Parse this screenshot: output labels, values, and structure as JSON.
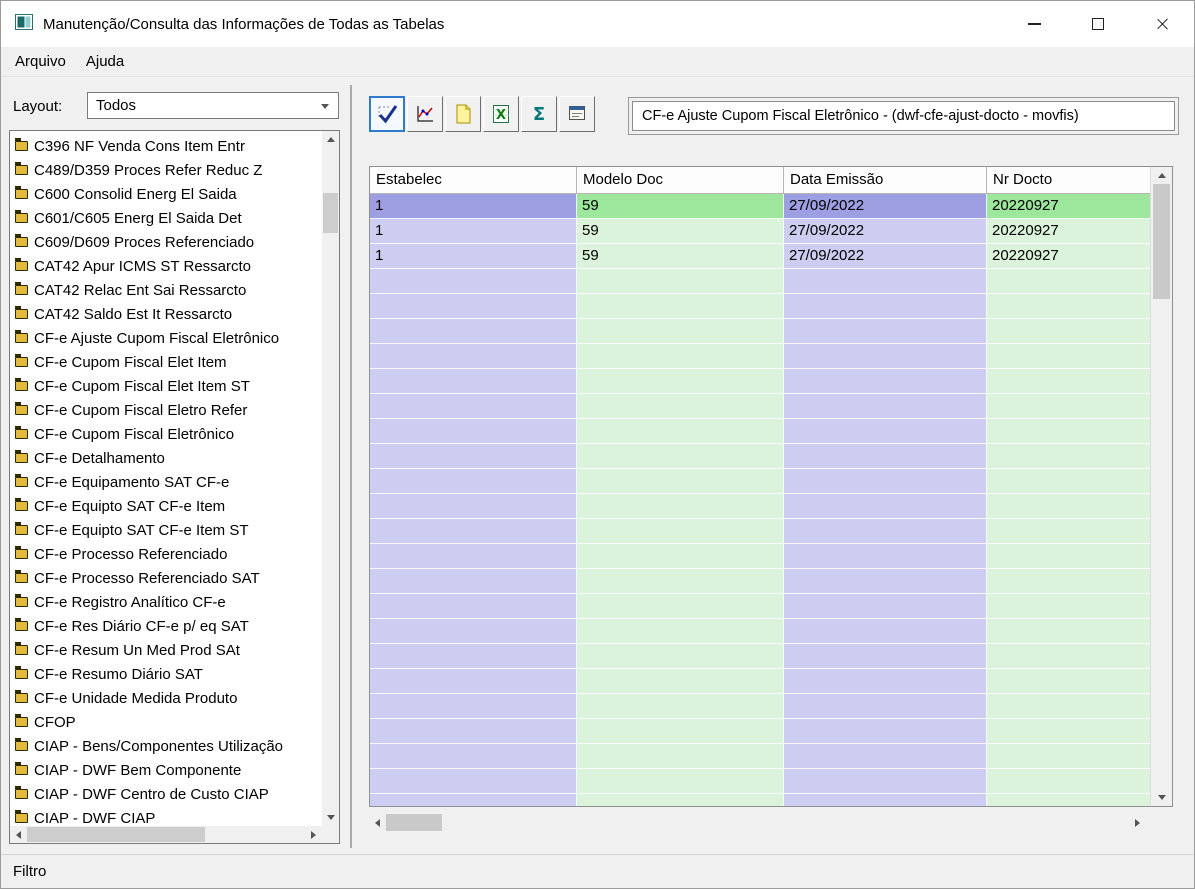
{
  "window": {
    "title": "Manutenção/Consulta das Informações de Todas as Tabelas"
  },
  "menu": {
    "items": [
      "Arquivo",
      "Ajuda"
    ]
  },
  "sidebar": {
    "layout_label": "Layout:",
    "layout_value": "Todos",
    "tables": [
      "C396 NF Venda Cons Item Entr",
      "C489/D359 Proces Refer Reduc Z",
      "C600 Consolid Energ El Saida",
      "C601/C605 Energ El Saida Det",
      "C609/D609 Proces Referenciado",
      "CAT42 Apur ICMS ST Ressarcto",
      "CAT42 Relac Ent Sai Ressarcto",
      "CAT42 Saldo Est It Ressarcto",
      "CF-e Ajuste Cupom Fiscal Eletrônico",
      "CF-e Cupom Fiscal Elet Item",
      "CF-e Cupom Fiscal Elet Item ST",
      "CF-e Cupom Fiscal Eletro Refer",
      "CF-e Cupom Fiscal Eletrônico",
      "CF-e Detalhamento",
      "CF-e Equipamento SAT CF-e",
      "CF-e Equipto SAT CF-e Item",
      "CF-e Equipto SAT CF-e Item ST",
      "CF-e Processo Referenciado",
      "CF-e Processo Referenciado SAT",
      "CF-e Registro Analítico CF-e",
      "CF-e Res Diário CF-e p/ eq SAT",
      "CF-e Resum Un Med Prod SAt",
      "CF-e Resumo Diário SAT",
      "CF-e Unidade Medida Produto",
      "CFOP",
      "CIAP - Bens/Componentes Utilização",
      "CIAP - DWF Bem Componente",
      "CIAP - DWF Centro de Custo CIAP",
      "CIAP - DWF CIAP"
    ]
  },
  "toolbar": {
    "buttons": [
      {
        "icon": "filter-check-icon"
      },
      {
        "icon": "chart-icon"
      },
      {
        "icon": "document-icon"
      },
      {
        "icon": "excel-icon",
        "glyph": "X"
      },
      {
        "icon": "sigma-icon",
        "glyph": "Σ"
      },
      {
        "icon": "properties-icon"
      }
    ],
    "selected_table": "CF-e Ajuste Cupom Fiscal Eletrônico - (dwf-cfe-ajust-docto - movfis)"
  },
  "grid": {
    "columns": [
      "Estabelec",
      "Modelo Doc",
      "Data Emissão",
      "Nr Docto"
    ],
    "rows": [
      [
        "1",
        "59",
        "27/09/2022",
        "20220927"
      ],
      [
        "1",
        "59",
        "27/09/2022",
        "20220927"
      ],
      [
        "1",
        "59",
        "27/09/2022",
        "20220927"
      ]
    ],
    "selected_row_index": 0
  },
  "statusbar": {
    "text": "Filtro"
  },
  "colors": {
    "col_purple": "#cdcdf1",
    "col_green": "#dbf3db",
    "col_purple_selected": "#9e9ee3",
    "col_green_selected": "#9ce79c",
    "accent_blue": "#2f7acc"
  }
}
